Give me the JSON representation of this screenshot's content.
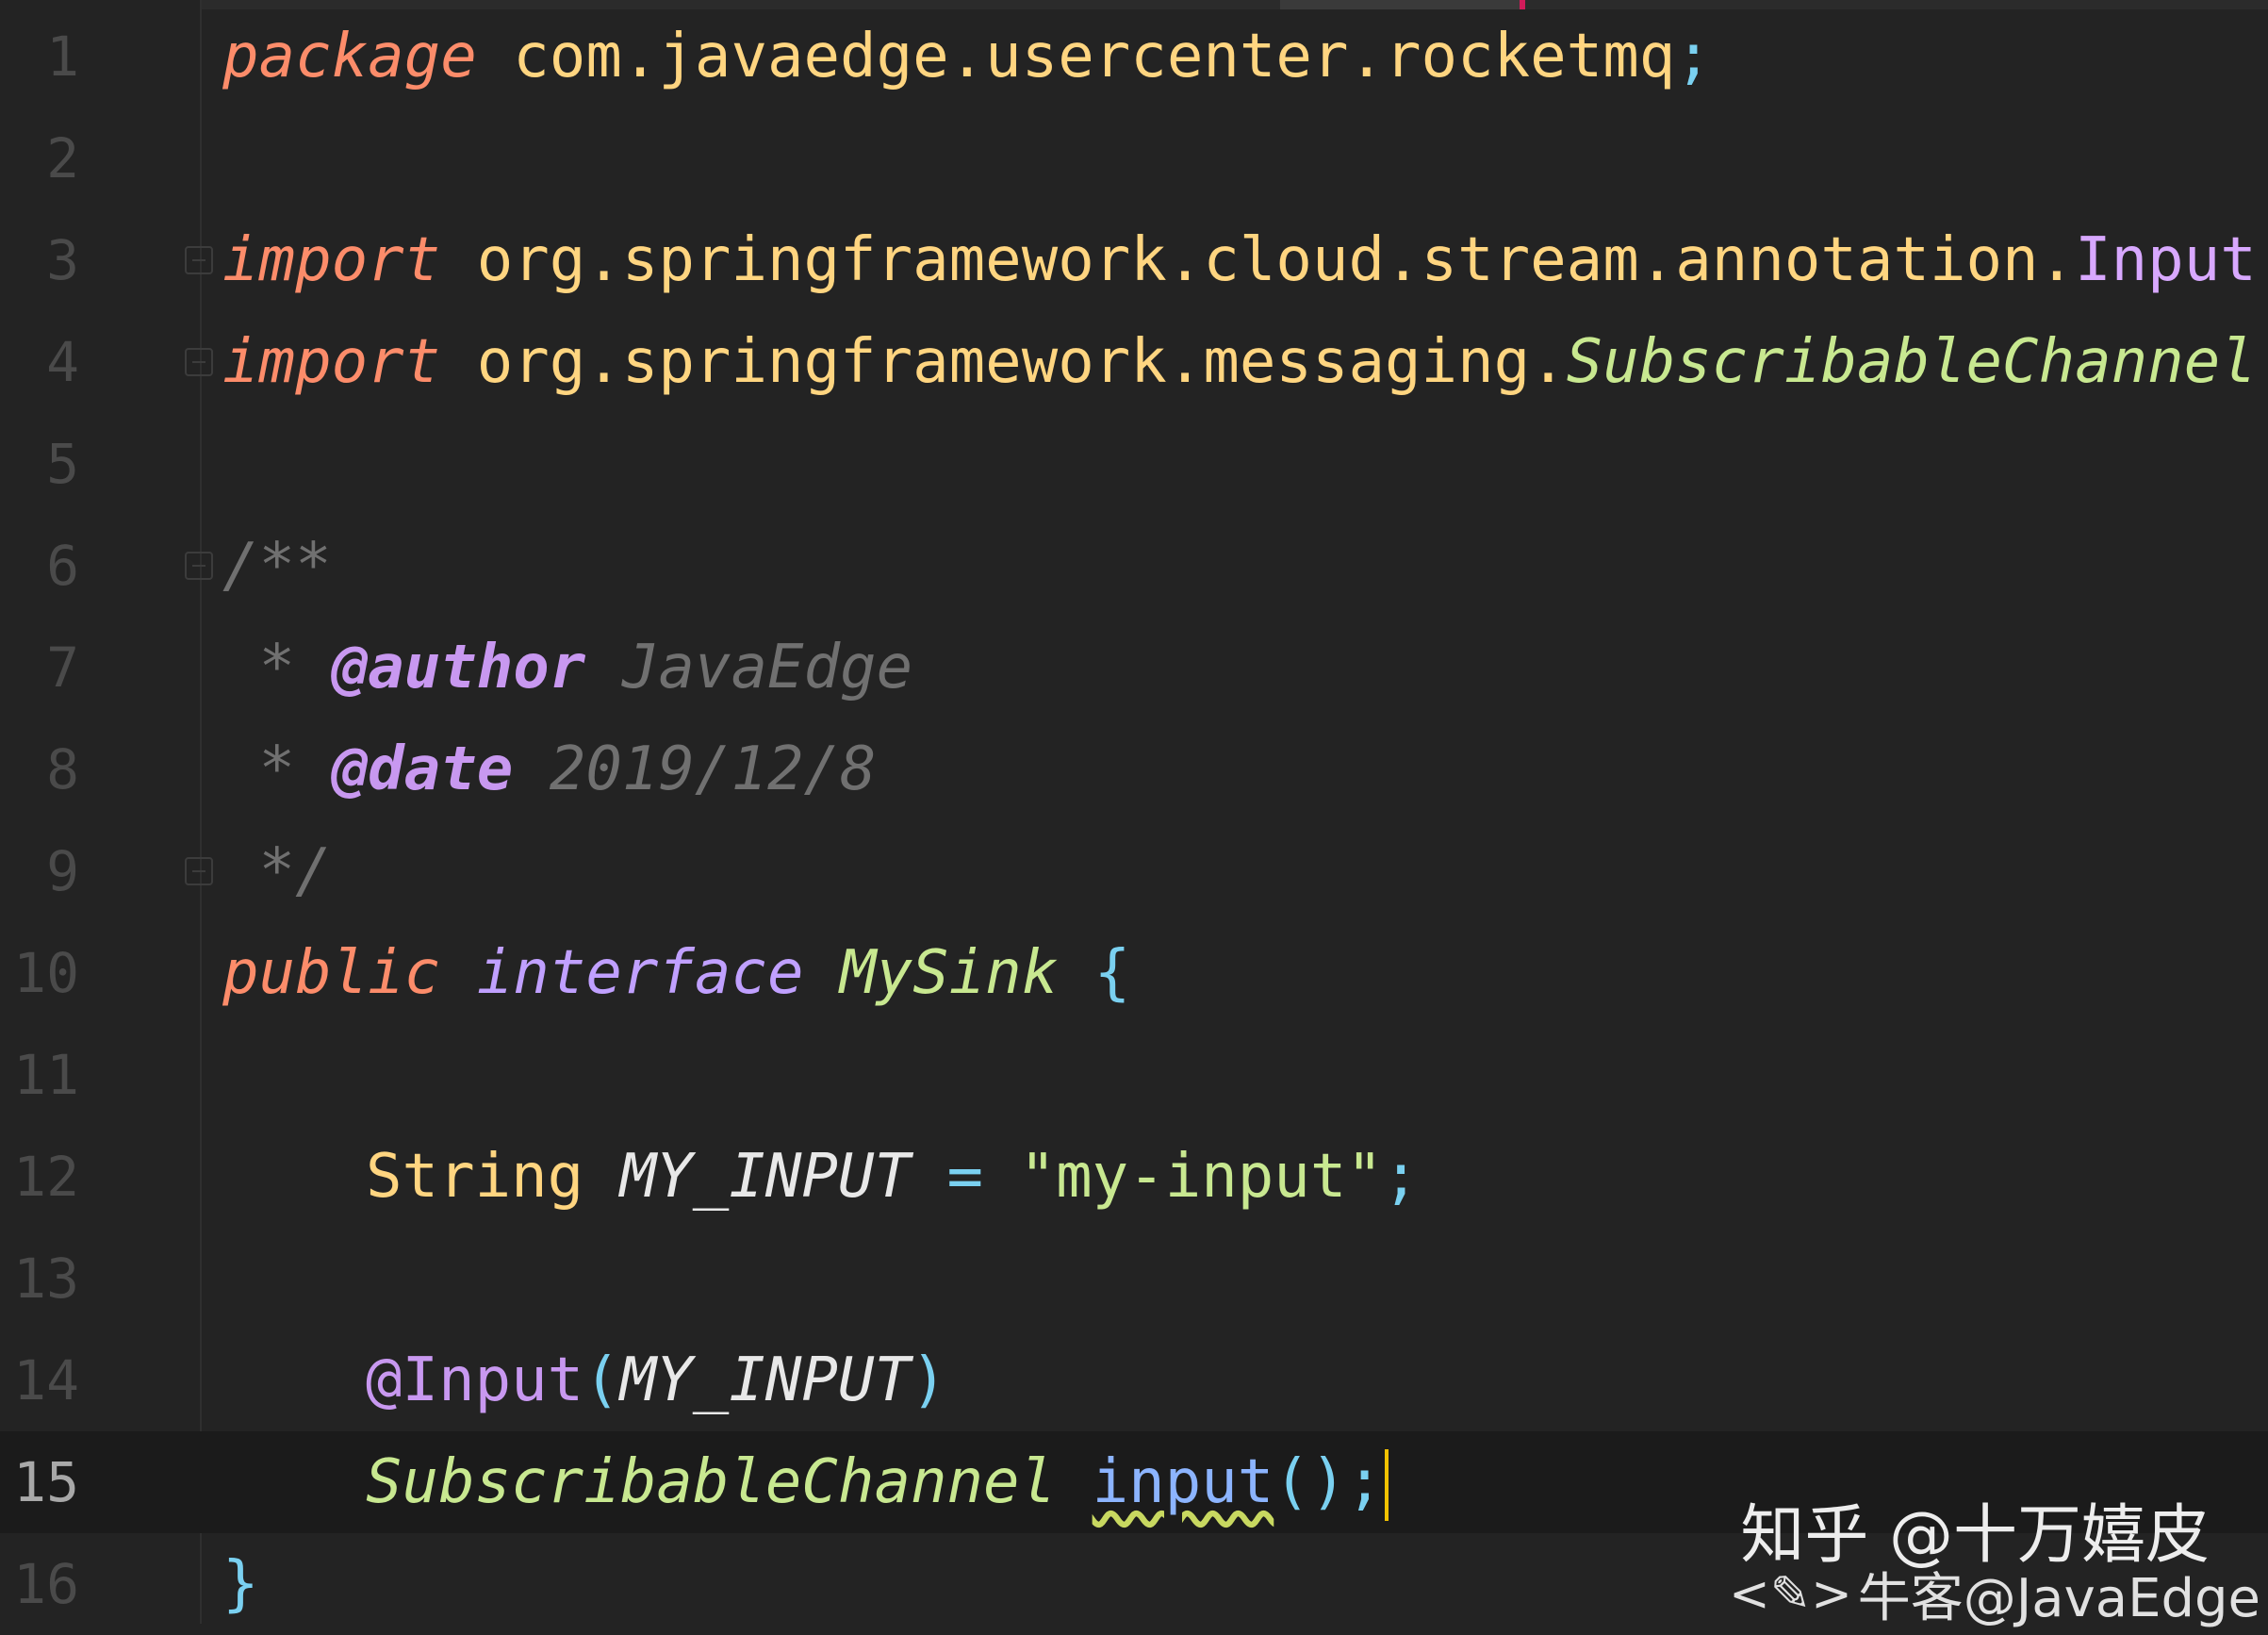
{
  "editor": {
    "lines": [
      {
        "n": "1",
        "tokens": [
          [
            "kw",
            "package"
          ],
          [
            "pkg",
            " com.javaedge.usercenter.rocketmq"
          ],
          [
            "punc",
            ";"
          ]
        ]
      },
      {
        "n": "2",
        "tokens": []
      },
      {
        "n": "3",
        "fold": true,
        "tokens": [
          [
            "kw",
            "import"
          ],
          [
            "pkg",
            " org.springframework.cloud.stream.annotation."
          ],
          [
            "cls",
            "Input"
          ],
          [
            "punc",
            ";"
          ]
        ]
      },
      {
        "n": "4",
        "fold": true,
        "tokens": [
          [
            "kw",
            "import"
          ],
          [
            "pkg",
            " org.springframework.messaging."
          ],
          [
            "typ",
            "SubscribableChannel"
          ],
          [
            "punc",
            ";"
          ]
        ]
      },
      {
        "n": "5",
        "tokens": []
      },
      {
        "n": "6",
        "fold": true,
        "tokens": [
          [
            "cmt",
            "/**"
          ]
        ]
      },
      {
        "n": "7",
        "tokens": [
          [
            "cmt",
            " * "
          ],
          [
            "tag",
            "@author"
          ],
          [
            "cmt",
            " JavaEdge"
          ]
        ]
      },
      {
        "n": "8",
        "tokens": [
          [
            "cmt",
            " * "
          ],
          [
            "tag",
            "@date"
          ],
          [
            "cmt",
            " 2019/12/8"
          ]
        ]
      },
      {
        "n": "9",
        "fold": true,
        "tokens": [
          [
            "cmt",
            " */"
          ]
        ]
      },
      {
        "n": "10",
        "tokens": [
          [
            "kw",
            "public"
          ],
          [
            "pkg",
            " "
          ],
          [
            "intf",
            "interface"
          ],
          [
            "pkg",
            " "
          ],
          [
            "typ",
            "MySink"
          ],
          [
            "pkg",
            " "
          ],
          [
            "punc",
            "{"
          ]
        ]
      },
      {
        "n": "11",
        "tokens": []
      },
      {
        "n": "12",
        "indent": true,
        "tokens": [
          [
            "typn",
            "String"
          ],
          [
            "pkg",
            " "
          ],
          [
            "konst",
            "MY_INPUT"
          ],
          [
            "pkg",
            " "
          ],
          [
            "op",
            "="
          ],
          [
            "pkg",
            " "
          ],
          [
            "str",
            "\"my-input\""
          ],
          [
            "punc",
            ";"
          ]
        ]
      },
      {
        "n": "13",
        "tokens": []
      },
      {
        "n": "14",
        "indent": true,
        "tokens": [
          [
            "ann",
            "@Input"
          ],
          [
            "punc",
            "("
          ],
          [
            "konst",
            "MY_INPUT"
          ],
          [
            "punc",
            ")"
          ]
        ]
      },
      {
        "n": "15",
        "indent": true,
        "current": true,
        "caret": true,
        "tokens": [
          [
            "typ",
            "SubscribableChannel"
          ],
          [
            "pkg",
            " "
          ],
          [
            "meth",
            "input"
          ],
          [
            "punc",
            "();"
          ]
        ]
      },
      {
        "n": "16",
        "tokens": [
          [
            "punc",
            "}"
          ]
        ]
      }
    ]
  },
  "watermark": {
    "zhihu": "知乎 @十万嬉皮",
    "nowcoder_icon": "edit-icon",
    "nowcoder": "牛客@JavaEdge"
  }
}
